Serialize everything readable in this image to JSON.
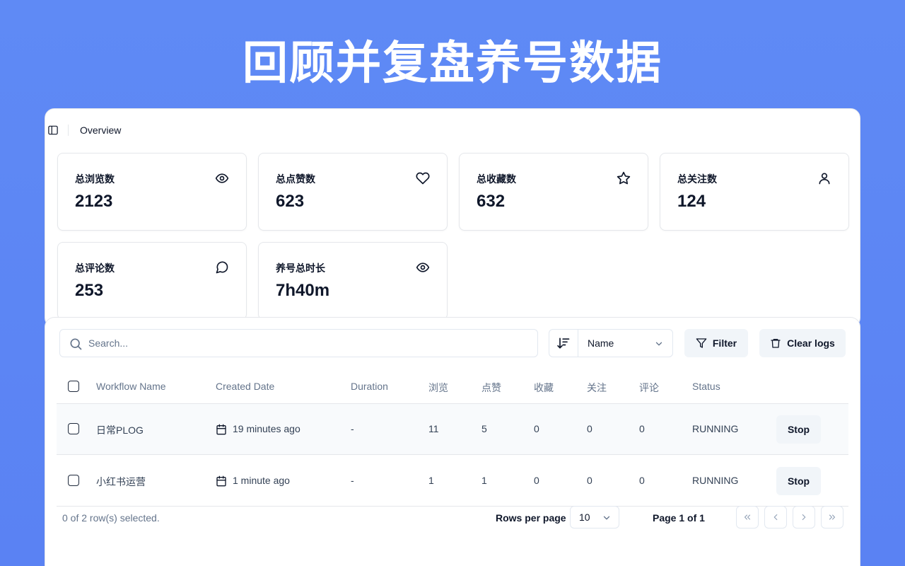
{
  "hero": {
    "title": "回顾并复盘养号数据"
  },
  "topbar": {
    "breadcrumb": "Overview"
  },
  "cards": [
    {
      "label": "总浏览数",
      "value": "2123",
      "icon": "eye-icon"
    },
    {
      "label": "总点赞数",
      "value": "623",
      "icon": "heart-icon"
    },
    {
      "label": "总收藏数",
      "value": "632",
      "icon": "star-icon"
    },
    {
      "label": "总关注数",
      "value": "124",
      "icon": "user-icon"
    },
    {
      "label": "总评论数",
      "value": "253",
      "icon": "message-circle-icon"
    },
    {
      "label": "养号总时长",
      "value": "7h40m",
      "icon": "eye-icon"
    }
  ],
  "toolbar": {
    "search_placeholder": "Search...",
    "sort_field": "Name",
    "filter_label": "Filter",
    "clear_logs_label": "Clear logs"
  },
  "table": {
    "headers": [
      "Workflow Name",
      "Created Date",
      "Duration",
      "浏览",
      "点赞",
      "收藏",
      "关注",
      "评论",
      "Status"
    ],
    "rows": [
      {
        "name": "日常PLOG",
        "created": "19 minutes ago",
        "duration": "-",
        "views": "11",
        "likes": "5",
        "saves": "0",
        "follows": "0",
        "comments": "0",
        "status": "RUNNING",
        "action": "Stop"
      },
      {
        "name": "小红书运营",
        "created": "1 minute ago",
        "duration": "-",
        "views": "1",
        "likes": "1",
        "saves": "0",
        "follows": "0",
        "comments": "0",
        "status": "RUNNING",
        "action": "Stop"
      }
    ]
  },
  "footer": {
    "selection": "0 of 2 row(s) selected.",
    "rows_per_page_label": "Rows per page",
    "rows_per_page_value": "10",
    "page_info": "Page 1 of 1"
  }
}
